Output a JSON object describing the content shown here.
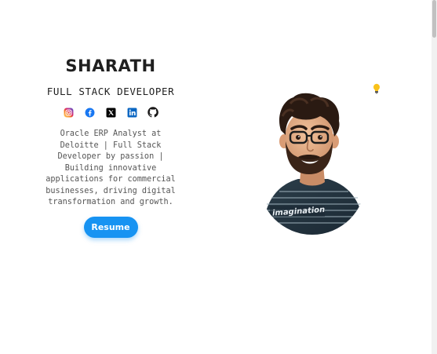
{
  "profile": {
    "name": "SHARATH",
    "role": "FULL STACK DEVELOPER",
    "bio": "Oracle ERP Analyst at Deloitte | Full Stack Developer by passion | Building innovative applications for commercial businesses, driving digital transformation and growth.",
    "resume_label": "Resume"
  },
  "avatar": {
    "shirt_text": "imagination"
  },
  "socials": [
    {
      "icon": "instagram-icon",
      "color": "#e1306c"
    },
    {
      "icon": "facebook-icon",
      "color": "#1877f2"
    },
    {
      "icon": "x-icon",
      "color": "#000000"
    },
    {
      "icon": "linkedin-icon",
      "color": "#0a66c2"
    },
    {
      "icon": "github-icon",
      "color": "#181717"
    }
  ],
  "theme": {
    "accent": "#1793f2",
    "toggle_icon": "lightbulb-icon"
  }
}
